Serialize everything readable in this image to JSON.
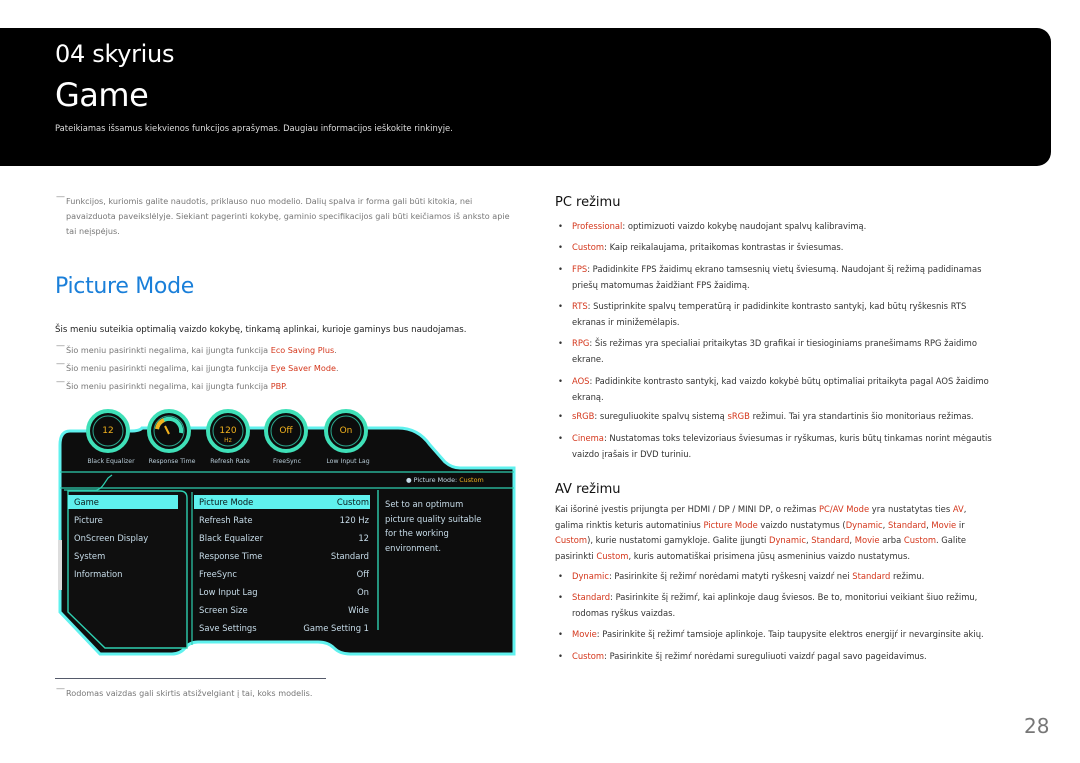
{
  "header": {
    "chapter": "04 skyrius",
    "title": "Game",
    "subtitle": "Pateikiamas išsamus kiekvienos funkcijos aprašymas. Daugiau informacijos ieškokite rinkinyje."
  },
  "intro_note": {
    "dash": "—",
    "lines": [
      "Funkcijos, kuriomis galite naudotis, priklauso nuo modelio. Dalių spalva ir forma gali būti kitokia, nei",
      "pavaizduota paveikslėlyje. Siekiant pagerinti kokybę, gaminio specifikacijos gali būti keičiamos iš anksto apie",
      "tai neįspėjus."
    ]
  },
  "section": {
    "title": "Picture Mode",
    "lead": "Šis meniu suteikia optimalią vaizdo kokybę, tinkamą aplinkai, kurioje gaminys bus naudojamas.",
    "notes": [
      {
        "prefix": "Šio meniu pasirinkti negalima, kai įjungta funkcija ",
        "highlight": "Eco Saving Plus",
        "suffix": "."
      },
      {
        "prefix": "Šio meniu pasirinkti negalima, kai įjungta funkcija ",
        "highlight": "Eye Saver Mode",
        "suffix": "."
      },
      {
        "prefix": "Šio meniu pasirinkti negalima, kai įjungta funkcija ",
        "highlight": "PBP",
        "suffix": "."
      }
    ]
  },
  "osd": {
    "dials": [
      {
        "value": "12",
        "unit": "",
        "label": "Black Equalizer"
      },
      {
        "value": "",
        "unit": "",
        "label": "Response Time",
        "gauge": true
      },
      {
        "value": "120",
        "unit": "Hz",
        "label": "Refresh Rate"
      },
      {
        "value": "Off",
        "unit": "",
        "label": "FreeSync"
      },
      {
        "value": "On",
        "unit": "",
        "label": "Low Input Lag"
      }
    ],
    "status_prefix": "Picture Mode: ",
    "status_value": "Custom",
    "categories": [
      "Game",
      "Picture",
      "OnScreen Display",
      "System",
      "Information"
    ],
    "selected_category": "Game",
    "settings": [
      {
        "name": "Picture Mode",
        "value": "Custom"
      },
      {
        "name": "Refresh Rate",
        "value": "120 Hz"
      },
      {
        "name": "Black Equalizer",
        "value": "12"
      },
      {
        "name": "Response Time",
        "value": "Standard"
      },
      {
        "name": "FreeSync",
        "value": "Off"
      },
      {
        "name": "Low Input Lag",
        "value": "On"
      },
      {
        "name": "Screen Size",
        "value": "Wide"
      },
      {
        "name": "Save Settings",
        "value": "Game Setting 1"
      }
    ],
    "description": [
      "Set to an optimum",
      "picture quality suitable",
      "for the working",
      "environment."
    ],
    "colors": {
      "accent": "#5ff1ee",
      "dial_value": "#f2b21e",
      "panel": "#111111"
    }
  },
  "pc_mode": {
    "title": "PC režimu",
    "items": [
      {
        "term": "Professional",
        "lines": [
          ": optimizuoti vaizdo kokybę naudojant spalvų kalibravimą."
        ]
      },
      {
        "term": "Custom",
        "lines": [
          ": Kaip reikalaujama, pritaikomas kontrastas ir šviesumas."
        ]
      },
      {
        "term": "FPS",
        "lines": [
          ": Padidinkite FPS žaidimų ekrano tamsesnių vietų šviesumą. Naudojant šį režimą padidinamas",
          "priešų matomumas žaidžiant FPS žaidimą."
        ]
      },
      {
        "term": "RTS",
        "lines": [
          ": Sustiprinkite spalvų temperatūrą ir padidinkite kontrasto santykį, kad būtų ryškesnis RTS",
          "ekranas ir minižemėlapis."
        ]
      },
      {
        "term": "RPG",
        "lines": [
          ": Šis režimas yra specialiai pritaikytas 3D grafikai ir tiesioginiams pranešimams RPG žaidimo",
          "ekrane."
        ]
      },
      {
        "term": "AOS",
        "lines": [
          ": Padidinkite kontrasto santykį, kad vaizdo kokybė būtų optimaliai pritaikyta pagal AOS žaidimo",
          "ekraną."
        ]
      },
      {
        "term": "sRGB",
        "lines": [
          ": sureguliuokite spalvų sistemą ",
          "sRGB",
          " režimui. Tai yra standartinis šio monitoriaus režimas."
        ],
        "inline_term": true
      },
      {
        "term": "Cinema",
        "lines": [
          ": Nustatomas toks televizoriaus šviesumas ir ryškumas, kuris būtų tinkamas norint mėgautis",
          "vaizdo įrašais ir DVD turiniu."
        ]
      }
    ]
  },
  "av_mode": {
    "title": "AV režimu",
    "paragraph": [
      [
        [
          "Kai išorinė įvestis prijungta per HDMI / DP / MINI DP, o režimas ",
          false
        ],
        [
          "PC/AV Mode",
          true
        ],
        [
          " yra nustatytas ties ",
          false
        ],
        [
          "AV",
          true
        ],
        [
          ",",
          false
        ]
      ],
      [
        [
          "galima rinktis keturis automatinius ",
          false
        ],
        [
          "Picture Mode",
          true
        ],
        [
          " vaizdo nustatymus (",
          false
        ],
        [
          "Dynamic",
          true
        ],
        [
          ", ",
          false
        ],
        [
          "Standard",
          true
        ],
        [
          ", ",
          false
        ],
        [
          "Movie",
          true
        ],
        [
          " ir",
          false
        ]
      ],
      [
        [
          "Custom",
          true
        ],
        [
          "), kurie nustatomi gamykloje. Galite įjungti ",
          false
        ],
        [
          "Dynamic",
          true
        ],
        [
          ", ",
          false
        ],
        [
          "Standard",
          true
        ],
        [
          ", ",
          false
        ],
        [
          "Movie",
          true
        ],
        [
          " arba ",
          false
        ],
        [
          "Custom",
          true
        ],
        [
          ". Galite",
          false
        ]
      ],
      [
        [
          "pasirinkti ",
          false
        ],
        [
          "Custom",
          true
        ],
        [
          ", kuris automatiškai prisimena jūsų asmeninius vaizdo nustatymus.",
          false
        ]
      ]
    ],
    "items": [
      {
        "term": "Dynamic",
        "lines": [
          [
            ": Pasirinkite šį režimŕ norėdami matyti ryškesnį vaizdŕ nei ",
            false
          ],
          [
            "Standard",
            true
          ],
          [
            " režimu.",
            false
          ]
        ]
      },
      {
        "term": "Standard",
        "lines": [
          [
            ": Pasirinkite šį režimŕ, kai aplinkoje daug šviesos. Be to, monitoriui veikiant šiuo režimu,",
            false
          ]
        ],
        "line2": "rodomas ryškus vaizdas."
      },
      {
        "term": "Movie",
        "lines": [
          [
            ": Pasirinkite šį režimŕ tamsioje aplinkoje. Taip taupysite elektros energijŕ ir nevarginsite akių.",
            false
          ]
        ]
      },
      {
        "term": "Custom",
        "lines": [
          [
            ": Pasirinkite šį režimŕ norėdami sureguliuoti vaizdŕ pagal savo pageidavimus.",
            false
          ]
        ]
      }
    ]
  },
  "footnote": {
    "dash": "—",
    "text": "Rodomas vaizdas gali skirtis atsižvelgiant į tai, koks modelis."
  },
  "page_number": "28",
  "colors": {
    "banner": "#000000",
    "heading_blue": "#1a7fd9",
    "highlight_red": "#d4361b"
  }
}
